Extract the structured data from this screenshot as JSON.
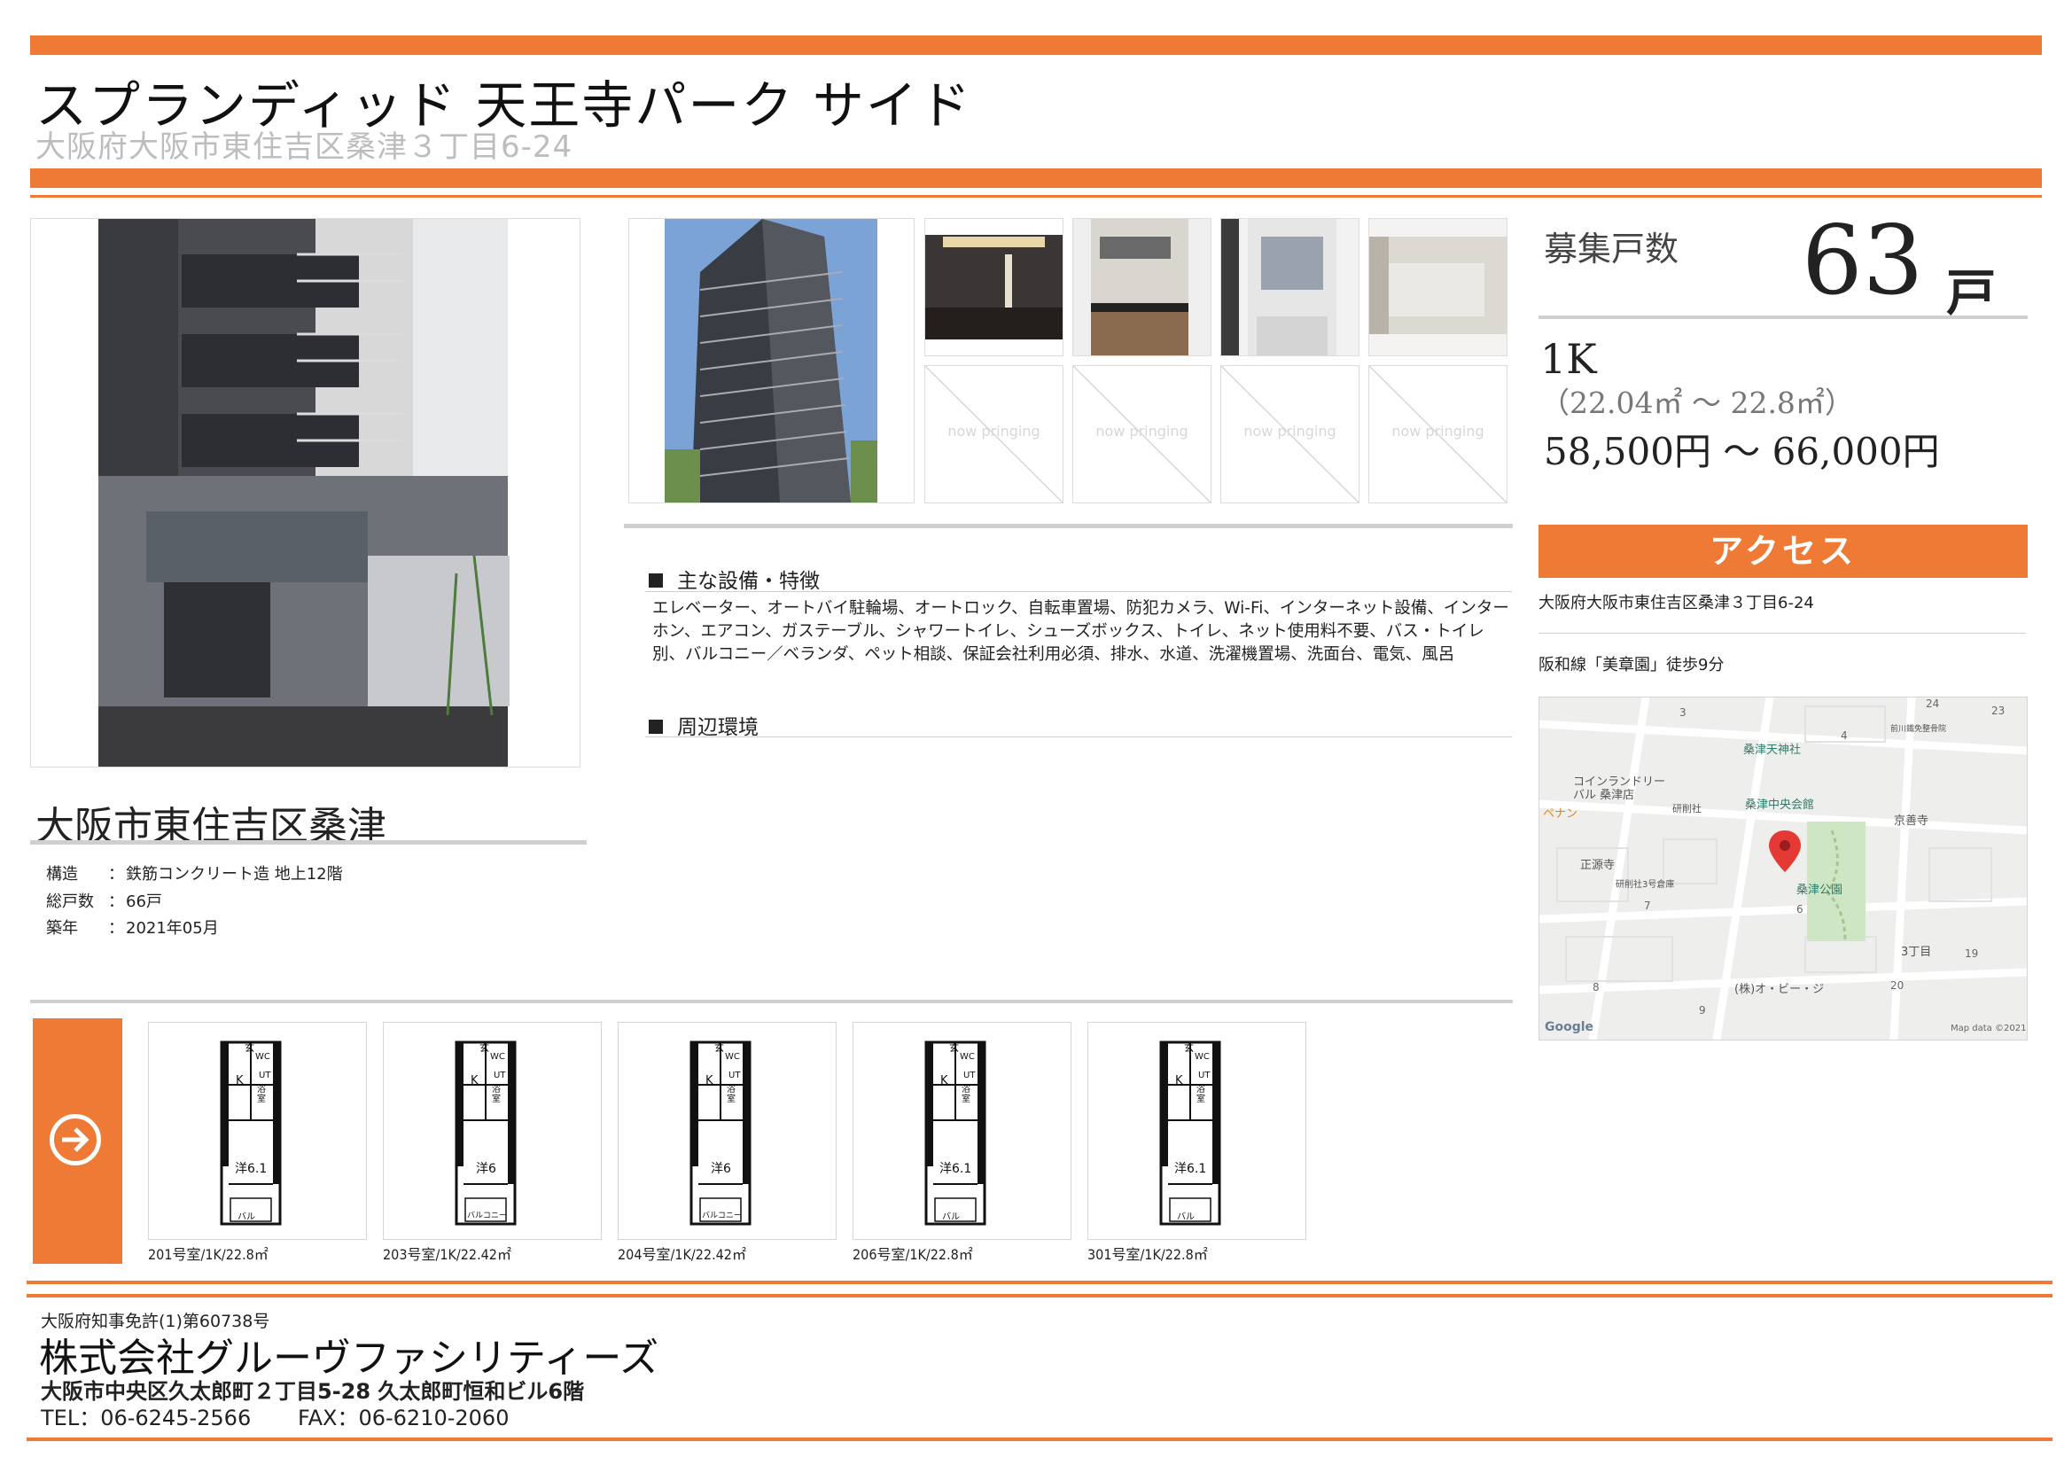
{
  "header": {
    "title": "スプランディッド 天王寺パーク サイド",
    "address": "大阪府大阪市東住吉区桑津３丁目6-24"
  },
  "thumbnails": {
    "placeholder_text": "now pringing"
  },
  "property": {
    "region": "大阪市東住吉区桑津",
    "info": [
      {
        "label": "構造",
        "sep": "：",
        "value": "鉄筋コンクリート造 地上12階"
      },
      {
        "label": "総戸数",
        "sep": "：",
        "value": "66戸"
      },
      {
        "label": "築年",
        "sep": "：",
        "value": "2021年05月"
      }
    ]
  },
  "features": {
    "heading": "主な設備・特徴",
    "text": "エレベーター、オートバイ駐輪場、オートロック、自転車置場、防犯カメラ、Wi-Fi、インターネット設備、インターホン、エアコン、ガステーブル、シャワートイレ、シューズボックス、トイレ、ネット使用料不要、バス・トイレ別、バルコニー／ベランダ、ペット相談、保証会社利用必須、排水、水道、洗濯機置場、洗面台、電気、風呂",
    "surroundings_heading": "周辺環境"
  },
  "recruit": {
    "label": "募集戸数",
    "count": "63",
    "unit": "戸",
    "layout": "1K",
    "area_range": "（22.04㎡ ～ 22.8㎡）",
    "rent_range": "58,500円 ～ 66,000円"
  },
  "access": {
    "heading": "アクセス",
    "address": "大阪府大阪市東住吉区桑津３丁目6-24",
    "station": "阪和線「美章園」徒歩9分"
  },
  "map": {
    "labels": [
      "コインランドリー",
      "バル 桑津店",
      "研削社",
      "桑津天神社",
      "桑津中央会館",
      "京善寺",
      "ペナン",
      "正源寺",
      "研削社3号倉庫",
      "桑津公園",
      "(株)オ・ビー・ジ",
      "3丁目",
      "前川鐵免整骨院"
    ],
    "numbers": [
      "3",
      "4",
      "24",
      "23",
      "7",
      "6",
      "8",
      "9",
      "19",
      "20"
    ],
    "google": "Google",
    "attribution": "Map data ©2021"
  },
  "floorplans": [
    {
      "caption": "201号室/1K/22.8㎡",
      "room": "洋6.1",
      "balcony": "バル"
    },
    {
      "caption": "203号室/1K/22.42㎡",
      "room": "洋6",
      "balcony": "バルコニー"
    },
    {
      "caption": "204号室/1K/22.42㎡",
      "room": "洋6",
      "balcony": "バルコニー"
    },
    {
      "caption": "206号室/1K/22.8㎡",
      "room": "洋6.1",
      "balcony": "バル"
    },
    {
      "caption": "301号室/1K/22.8㎡",
      "room": "洋6.1",
      "balcony": "バル"
    }
  ],
  "floorplan_labels": {
    "entry": "玄",
    "wc": "WC",
    "ut": "UT",
    "kitchen": "K",
    "bath": "浴室"
  },
  "footer": {
    "license": "大阪府知事免許(1)第60738号",
    "company": "株式会社グルーヴファシリティーズ",
    "address": "大阪市中央区久太郎町２丁目5-28 久太郎町恒和ビル6階",
    "tel": "TEL：06-6245-2566",
    "fax": "FAX：06-6210-2060"
  },
  "colors": {
    "accent": "#ee7a35",
    "rule": "#cfcfcf"
  }
}
